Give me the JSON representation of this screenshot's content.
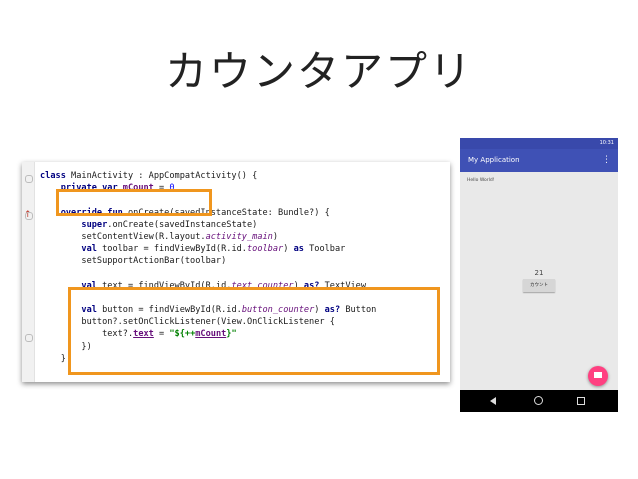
{
  "slide": {
    "title": "カウンタアプリ"
  },
  "code_lines": [
    [
      [
        "kw",
        "class "
      ],
      [
        "",
        "MainActivity : AppCompatActivity() {"
      ]
    ],
    [
      [
        "",
        "    "
      ],
      [
        "kw",
        "private var "
      ],
      [
        "prop",
        "mCount"
      ],
      [
        "",
        " = "
      ],
      [
        "num",
        "0"
      ]
    ],
    [
      [
        "",
        ""
      ]
    ],
    [
      [
        "",
        "    "
      ],
      [
        "kw",
        "override fun "
      ],
      [
        "",
        "onCreate(savedInstanceState: Bundle?) {"
      ]
    ],
    [
      [
        "",
        "        "
      ],
      [
        "kw",
        "super"
      ],
      [
        "",
        ".onCreate(savedInstanceState)"
      ]
    ],
    [
      [
        "",
        "        setContentView(R.layout."
      ],
      [
        "it",
        "activity_main"
      ],
      [
        "",
        ")"
      ]
    ],
    [
      [
        "",
        "        "
      ],
      [
        "kw",
        "val "
      ],
      [
        "",
        "toolbar = findViewById(R.id."
      ],
      [
        "it",
        "toolbar"
      ],
      [
        "",
        ") "
      ],
      [
        "kw",
        "as "
      ],
      [
        "",
        "Toolbar"
      ]
    ],
    [
      [
        "",
        "        setSupportActionBar(toolbar)"
      ]
    ],
    [
      [
        "",
        ""
      ]
    ],
    [
      [
        "",
        "        "
      ],
      [
        "kw",
        "val "
      ],
      [
        "",
        "text = findViewById(R.id."
      ],
      [
        "it",
        "text_counter"
      ],
      [
        "",
        ") "
      ],
      [
        "kw",
        "as? "
      ],
      [
        "",
        "TextView"
      ]
    ],
    [
      [
        "",
        ""
      ]
    ],
    [
      [
        "",
        "        "
      ],
      [
        "kw",
        "val "
      ],
      [
        "",
        "button = findViewById(R.id."
      ],
      [
        "it",
        "button_counter"
      ],
      [
        "",
        ") "
      ],
      [
        "kw",
        "as? "
      ],
      [
        "",
        "Button"
      ]
    ],
    [
      [
        "",
        "        button?.setOnClickListener(View.OnClickListener {"
      ]
    ],
    [
      [
        "",
        "            text?."
      ],
      [
        "prop",
        "text"
      ],
      [
        "",
        " = "
      ],
      [
        "str",
        "\"${++"
      ],
      [
        "prop",
        "mCount"
      ],
      [
        "str",
        "}\""
      ]
    ],
    [
      [
        "",
        "        })"
      ]
    ],
    [
      [
        "",
        "    }"
      ]
    ]
  ],
  "phone": {
    "status_time": "10:31",
    "app_title": "My Application",
    "hello_text": "Hello World!",
    "counter_value": "21",
    "count_button_label": "カウント",
    "fab_icon": "mail-icon",
    "accent_color": "#3f51b5",
    "fab_color": "#ff4081"
  },
  "highlight_color": "#f0961e"
}
